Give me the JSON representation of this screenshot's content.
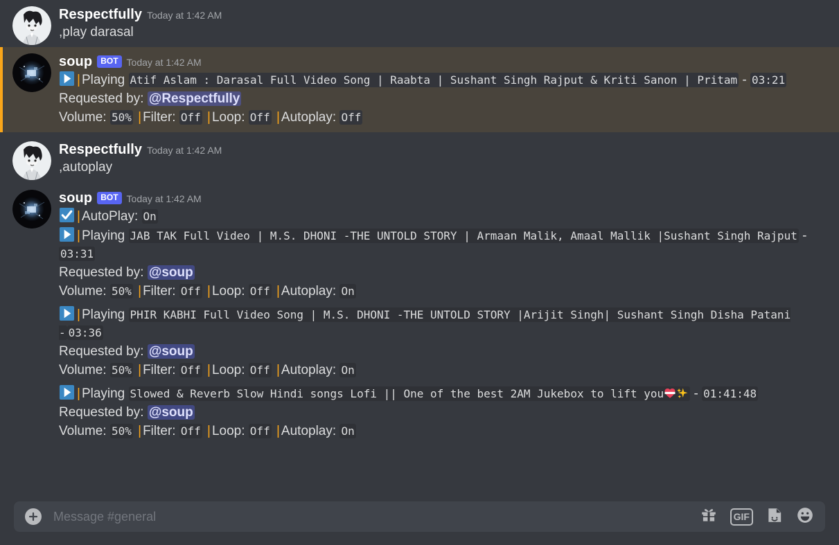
{
  "app": "discord",
  "colors": {
    "background": "#36393f",
    "mention_highlight": "#49443c",
    "mention_border": "#faa61a",
    "bot_badge": "#5865f2",
    "code_bg": "#2f3136",
    "text": "#dcddde",
    "muted": "#a3a6aa"
  },
  "messages": [
    {
      "id": "m1",
      "author": "Respectfully",
      "is_bot": false,
      "timestamp": "Today at 1:42 AM",
      "mention_highlight": false,
      "body": ",play darasal"
    },
    {
      "id": "m2",
      "author": "soup",
      "bot_label": "BOT",
      "is_bot": true,
      "timestamp": "Today at 1:42 AM",
      "mention_highlight": true,
      "playing_label": "Playing",
      "track_title": "Atif Aslam : Darasal Full Video Song | Raabta | Sushant Singh Rajput & Kriti Sanon | Pritam",
      "dash": " - ",
      "duration": "03:21",
      "requested_label": "Requested by:",
      "requested_by": "@Respectfully",
      "volume_label": "Volume:",
      "volume": "50%",
      "filter_label": "Filter:",
      "filter": "Off",
      "loop_label": "Loop:",
      "loop": "Off",
      "autoplay_label": "Autoplay:",
      "autoplay": "Off"
    },
    {
      "id": "m3",
      "author": "Respectfully",
      "is_bot": false,
      "timestamp": "Today at 1:42 AM",
      "mention_highlight": false,
      "body": ",autoplay"
    },
    {
      "id": "m4",
      "author": "soup",
      "bot_label": "BOT",
      "is_bot": true,
      "timestamp": "Today at 1:42 AM",
      "mention_highlight": false,
      "autoplay_status_label": "AutoPlay:",
      "autoplay_status": "On",
      "tracks": [
        {
          "playing_label": "Playing",
          "track_title": "JAB TAK Full Video | M.S. DHONI -THE UNTOLD STORY | Armaan Malik, Amaal Mallik |Sushant Singh Rajput",
          "dash": " - ",
          "duration": "03:31",
          "requested_label": "Requested by:",
          "requested_by": "@soup",
          "volume_label": "Volume:",
          "volume": "50%",
          "filter_label": "Filter:",
          "filter": "Off",
          "loop_label": "Loop:",
          "loop": "Off",
          "autoplay_label": "Autoplay:",
          "autoplay": "On"
        },
        {
          "playing_label": "Playing",
          "track_title": "PHIR KABHI Full Video Song | M.S. DHONI -THE UNTOLD STORY |Arijit Singh| Sushant Singh Disha Patani -",
          "dash": "",
          "duration": "03:36",
          "requested_label": "Requested by:",
          "requested_by": "@soup",
          "volume_label": "Volume:",
          "volume": "50%",
          "filter_label": "Filter:",
          "filter": "Off",
          "loop_label": "Loop:",
          "loop": "Off",
          "autoplay_label": "Autoplay:",
          "autoplay": "On"
        },
        {
          "playing_label": "Playing",
          "track_title_pre": "Slowed & Reverb Slow Hindi songs Lofi || One of the best 2AM Jukebox to lift you",
          "track_title_emoji": "heart-emoji sparkles-emoji",
          "dash": " - ",
          "duration": "01:41:48",
          "requested_label": "Requested by:",
          "requested_by": "@soup",
          "volume_label": "Volume:",
          "volume": "50%",
          "filter_label": "Filter:",
          "filter": "Off",
          "loop_label": "Loop:",
          "loop": "Off",
          "autoplay_label": "Autoplay:",
          "autoplay": "On"
        }
      ]
    }
  ],
  "composer": {
    "placeholder": "Message #general",
    "value": "",
    "icons": [
      "gift-icon",
      "gif-icon",
      "sticker-icon",
      "emoji-icon"
    ],
    "gif_label": "GIF"
  }
}
